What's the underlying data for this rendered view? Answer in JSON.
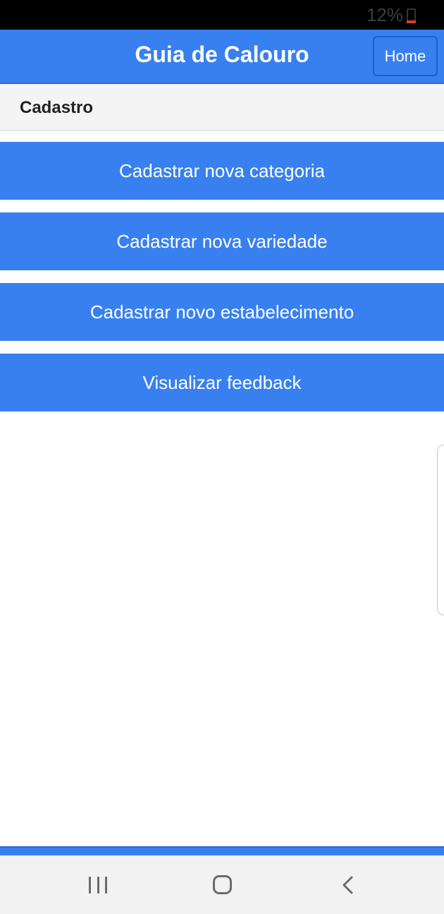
{
  "status_bar": {
    "battery_percent": "12%",
    "battery_icon": "battery-low-icon"
  },
  "header": {
    "title": "Guia de Calouro",
    "home_label": "Home"
  },
  "section": {
    "title": "Cadastro"
  },
  "actions": [
    {
      "label": "Cadastrar nova categoria"
    },
    {
      "label": "Cadastrar nova variedade"
    },
    {
      "label": "Cadastrar novo estabelecimento"
    },
    {
      "label": "Visualizar feedback"
    }
  ],
  "navigation": {
    "recents_icon": "recent-apps-icon",
    "home_icon": "home-icon",
    "back_icon": "back-icon"
  },
  "colors": {
    "primary": "#3880f0",
    "status_bar": "#000000",
    "section_background": "#f4f4f4",
    "nav_background": "#f2f2f2",
    "battery_warning": "#e53935"
  }
}
